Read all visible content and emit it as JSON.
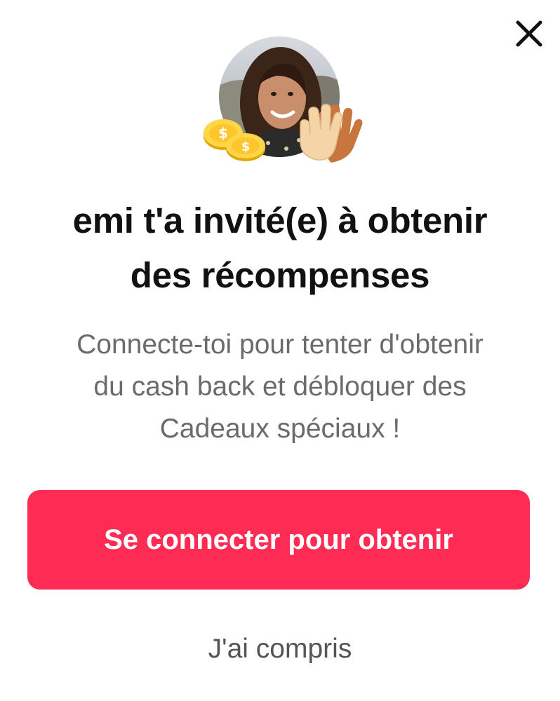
{
  "modal": {
    "close_icon": "close-icon",
    "avatar_icon": "avatar",
    "coins_icon": "coins-icon",
    "high_five_icon": "high-five-icon",
    "title_line1": "emi t'a invité(e) à obtenir",
    "title_line2": "des récompenses",
    "description_line1": "Connecte-toi pour tenter d'obtenir",
    "description_line2": "du cash back et débloquer des",
    "description_line3": "Cadeaux spéciaux !",
    "primary_button": "Se connecter pour obtenir",
    "secondary_button": "J'ai compris"
  },
  "colors": {
    "primary": "#fe2c55",
    "text_dark": "#111111",
    "text_muted": "#6b6b6b",
    "background": "#ffffff"
  }
}
